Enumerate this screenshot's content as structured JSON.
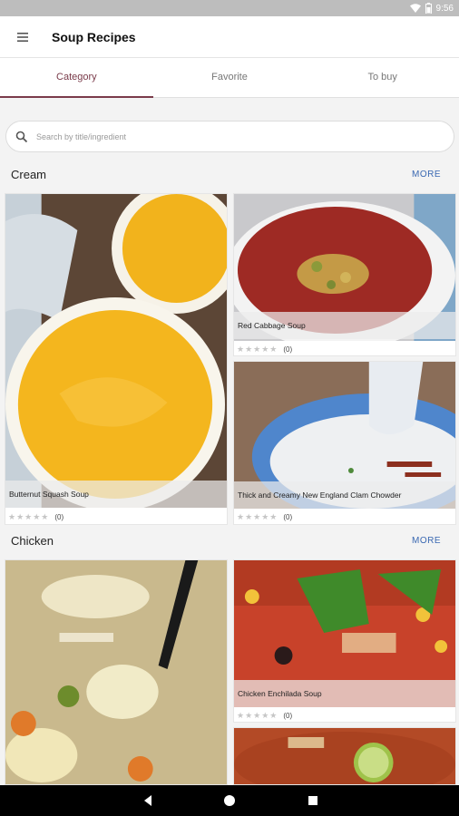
{
  "status_bar": {
    "time": "9:56"
  },
  "app_bar": {
    "title": "Soup Recipes"
  },
  "tabs": [
    {
      "label": "Category",
      "active": true
    },
    {
      "label": "Favorite",
      "active": false
    },
    {
      "label": "To buy",
      "active": false
    }
  ],
  "search": {
    "placeholder": "Search by title/ingredient",
    "value": ""
  },
  "sections": [
    {
      "title": "Cream",
      "more_label": "MORE",
      "recipes": [
        {
          "name": "Butternut Squash Soup",
          "rating_count": "(0)"
        },
        {
          "name": "Red Cabbage Soup",
          "rating_count": "(0)"
        },
        {
          "name": "Thick and Creamy New England Clam Chowder",
          "rating_count": "(0)"
        }
      ]
    },
    {
      "title": "Chicken",
      "more_label": "MORE",
      "recipes": [
        {
          "name": "",
          "rating_count": ""
        },
        {
          "name": "Chicken Enchilada Soup",
          "rating_count": "(0)"
        },
        {
          "name": "",
          "rating_count": ""
        }
      ]
    }
  ],
  "colors": {
    "accent": "#7a3b4a",
    "more_link": "#3a68b2",
    "status_bar": "#bdbdbd"
  }
}
